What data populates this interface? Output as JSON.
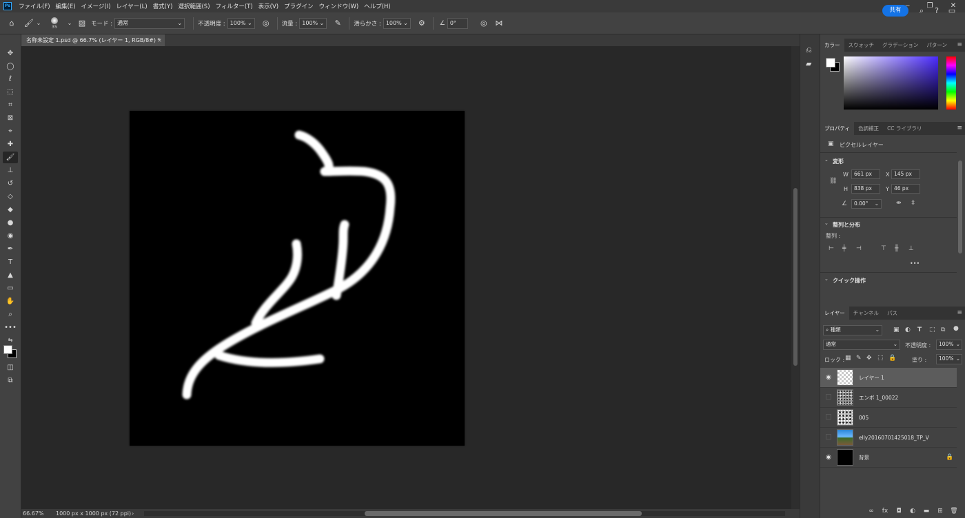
{
  "menubar": {
    "logo": "Ps",
    "items": [
      "ファイル(F)",
      "編集(E)",
      "イメージ(I)",
      "レイヤー(L)",
      "書式(Y)",
      "選択範囲(S)",
      "フィルター(T)",
      "表示(V)",
      "プラグイン",
      "ウィンドウ(W)",
      "ヘルプ(H)"
    ],
    "window_controls": [
      "—",
      "❐",
      "✕"
    ]
  },
  "options": {
    "brush_size": "35",
    "mode_label": "モード :",
    "mode_value": "通常",
    "opacity_label": "不透明度 :",
    "opacity_value": "100%",
    "flow_label": "流量 :",
    "flow_value": "100%",
    "smoothing_label": "滑らかさ :",
    "smoothing_value": "100%",
    "angle_value": "0°",
    "share_label": "共有"
  },
  "document": {
    "tab_title": "名称未設定 1.psd @ 66.7% (レイヤー 1, RGB/8#) *",
    "zoom": "66.67%",
    "doc_size": "1000 px x 1000 px (72 ppi)"
  },
  "color_panel": {
    "tabs": [
      "カラー",
      "スウォッチ",
      "グラデーション",
      "パターン"
    ],
    "foreground": "#ffffff",
    "background": "#000000"
  },
  "properties_panel": {
    "tabs": [
      "プロパティ",
      "色調補正",
      "CC ライブラリ"
    ],
    "layer_type": "ピクセルレイヤー",
    "transform_title": "変形",
    "w_label": "W",
    "w_value": "661 px",
    "x_label": "X",
    "x_value": "145 px",
    "h_label": "H",
    "h_value": "838 px",
    "y_label": "Y",
    "y_value": "46 px",
    "angle_value": "0.00°",
    "align_title": "整列と分布",
    "align_label": "整列 :",
    "more": "•••",
    "quick_actions_title": "クイック操作"
  },
  "layers_panel": {
    "tabs": [
      "レイヤー",
      "チャンネル",
      "パス"
    ],
    "filter_value": "種類",
    "blend_mode": "通常",
    "opacity_label": "不透明度 :",
    "opacity_value": "100%",
    "lock_label": "ロック :",
    "fill_label": "塗り :",
    "fill_value": "100%",
    "layers": [
      {
        "name": "レイヤー 1",
        "visible": true,
        "selected": true,
        "thumb": "transparent"
      },
      {
        "name": "エンボ 1_00022",
        "visible": false,
        "selected": false,
        "thumb": "noise"
      },
      {
        "name": "005",
        "visible": false,
        "selected": false,
        "thumb": "noise2"
      },
      {
        "name": "elly20160701425018_TP_V",
        "visible": false,
        "selected": false,
        "thumb": "photo"
      },
      {
        "name": "背景",
        "visible": true,
        "selected": false,
        "thumb": "black",
        "locked": true
      }
    ]
  }
}
